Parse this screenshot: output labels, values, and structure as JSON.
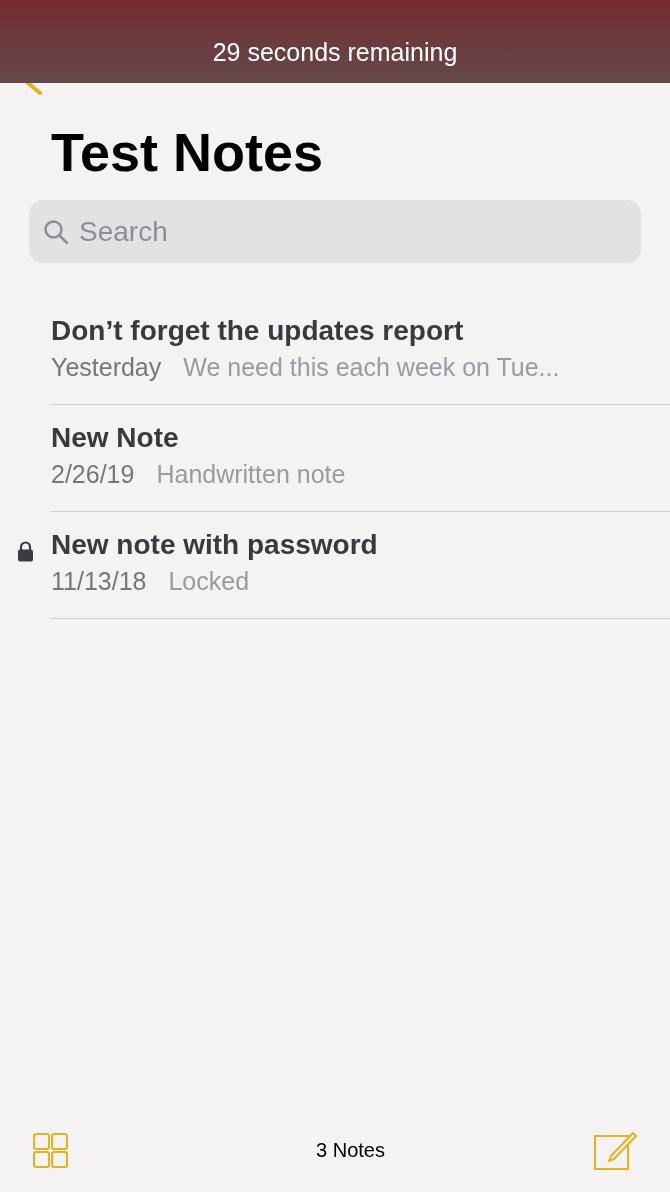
{
  "banner": {
    "text": "29 seconds remaining"
  },
  "title": "Test Notes",
  "search": {
    "placeholder": "Search"
  },
  "notes": [
    {
      "title": "Don’t forget the updates report",
      "date": "Yesterday",
      "preview": "We need this each week on Tue...",
      "locked": false
    },
    {
      "title": "New Note",
      "date": "2/26/19",
      "preview": "Handwritten note",
      "locked": false
    },
    {
      "title": "New note with password",
      "date": "11/13/18",
      "preview": "Locked",
      "locked": true
    }
  ],
  "toolbar": {
    "count": "3 Notes"
  }
}
